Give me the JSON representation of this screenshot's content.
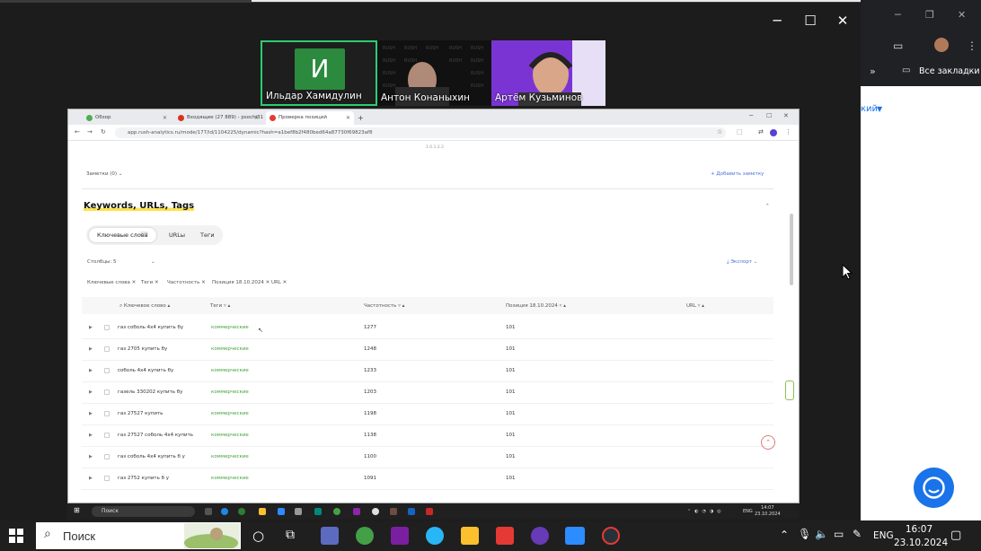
{
  "participants": [
    {
      "name": "Ильдар Хамидулин",
      "avatar_letter": "И"
    },
    {
      "name": "Антон Конаныхин"
    },
    {
      "name": "Артём Кузьминов"
    }
  ],
  "bg_browser": {
    "bookmarks_label": "Все закладки",
    "partial_text": "кий"
  },
  "inner_browser": {
    "tabs": [
      {
        "label": "Обзор"
      },
      {
        "label": "Входящие (27 889) - psochi31"
      },
      {
        "label": "Проверка позиций"
      }
    ],
    "address": "app.rush-analytics.ru/mode/177/id/1104225/dynamic?hash=a1bef8b2f480bed64a87730f69823af8",
    "top_fragment": "1.0.1.2.2",
    "notes_label": "Заметки (0)",
    "add_note_label": "+ Добавить заметку",
    "section_title": "Keywords, URLs, Tags",
    "tabs_inner": {
      "keywords": "Ключевые слова",
      "keywords_count": "220",
      "urls": "URLы",
      "tags": "Теги"
    },
    "columns_select": "Столбцы: 5",
    "export_label": "Экспорт",
    "chips": [
      "Ключевые слова",
      "Теги",
      "Частотность",
      "Позиция 18.10.2024",
      "URL"
    ],
    "headers": {
      "keyword": "Ключевое слово",
      "tags": "Теги",
      "frequency": "Частотность",
      "position": "Позиция 18.10.2024",
      "url": "URL"
    },
    "rows": [
      {
        "keyword": "газ соболь 4х4 купить бу",
        "tag": "коммерческие",
        "frequency": "1277",
        "position": "101"
      },
      {
        "keyword": "газ 2705 купить бу",
        "tag": "коммерческие",
        "frequency": "1248",
        "position": "101"
      },
      {
        "keyword": "соболь 4х4 купить бу",
        "tag": "коммерческие",
        "frequency": "1233",
        "position": "101"
      },
      {
        "keyword": "газель 330202 купить бу",
        "tag": "коммерческие",
        "frequency": "1203",
        "position": "101"
      },
      {
        "keyword": "газ 27527 купить",
        "tag": "коммерческие",
        "frequency": "1198",
        "position": "101"
      },
      {
        "keyword": "газ 27527 соболь 4х4 купить",
        "tag": "коммерческие",
        "frequency": "1138",
        "position": "101"
      },
      {
        "keyword": "газ соболь 4х4 купить б у",
        "tag": "коммерческие",
        "frequency": "1100",
        "position": "101"
      },
      {
        "keyword": "газ 2752 купить б у",
        "tag": "коммерческие",
        "frequency": "1091",
        "position": "101"
      }
    ],
    "taskbar": {
      "search": "Поиск",
      "time": "14:07",
      "date": "23.10.2024",
      "lang": "ENG"
    }
  },
  "taskbar": {
    "search": "Поиск",
    "lang": "ENG",
    "time": "16:07",
    "date": "23.10.2024"
  }
}
